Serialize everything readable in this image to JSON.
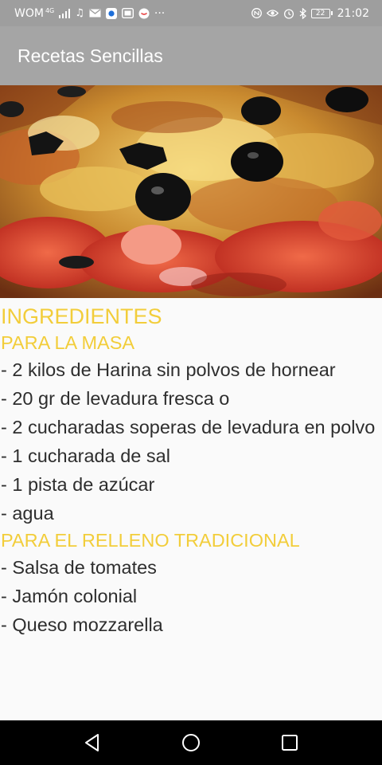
{
  "status_bar": {
    "carrier": "WOM",
    "network": "4G",
    "time": "21:02",
    "battery": "22",
    "overflow": "···",
    "left_icons": [
      "signal-icon",
      "music-icon",
      "mail-icon",
      "app-badge-icon",
      "gallery-icon",
      "chat-icon"
    ],
    "right_icons": [
      "nfc-icon",
      "eye-comfort-icon",
      "alarm-icon",
      "bluetooth-icon"
    ]
  },
  "app_bar": {
    "title": "Recetas Sencillas"
  },
  "hero_image": {
    "subject": "pizza-photo"
  },
  "recipe": {
    "ingredients_heading": "INGREDIENTES",
    "section_dough": "PARA LA MASA",
    "dough_items": [
      "- 2 kilos de Harina sin polvos de hornear",
      "- 20 gr de levadura fresca o",
      "- 2 cucharadas soperas de levadura en polvo",
      "- 1 cucharada de sal",
      "- 1 pista de azúcar",
      "- agua"
    ],
    "section_filling": "PARA EL RELLENO TRADICIONAL",
    "filling_items": [
      "- Salsa de tomates",
      "- Jamón colonial",
      "- Queso mozzarella"
    ]
  },
  "nav_bar": {
    "icons": [
      "back-icon",
      "home-icon",
      "recents-icon"
    ]
  },
  "colors": {
    "status_bar": "#9e9e9e",
    "app_bar": "#a5a5a5",
    "heading": "#f2cd3a",
    "body_text": "#2e2e2e",
    "background": "#fafafa",
    "nav_bar": "#000000"
  }
}
